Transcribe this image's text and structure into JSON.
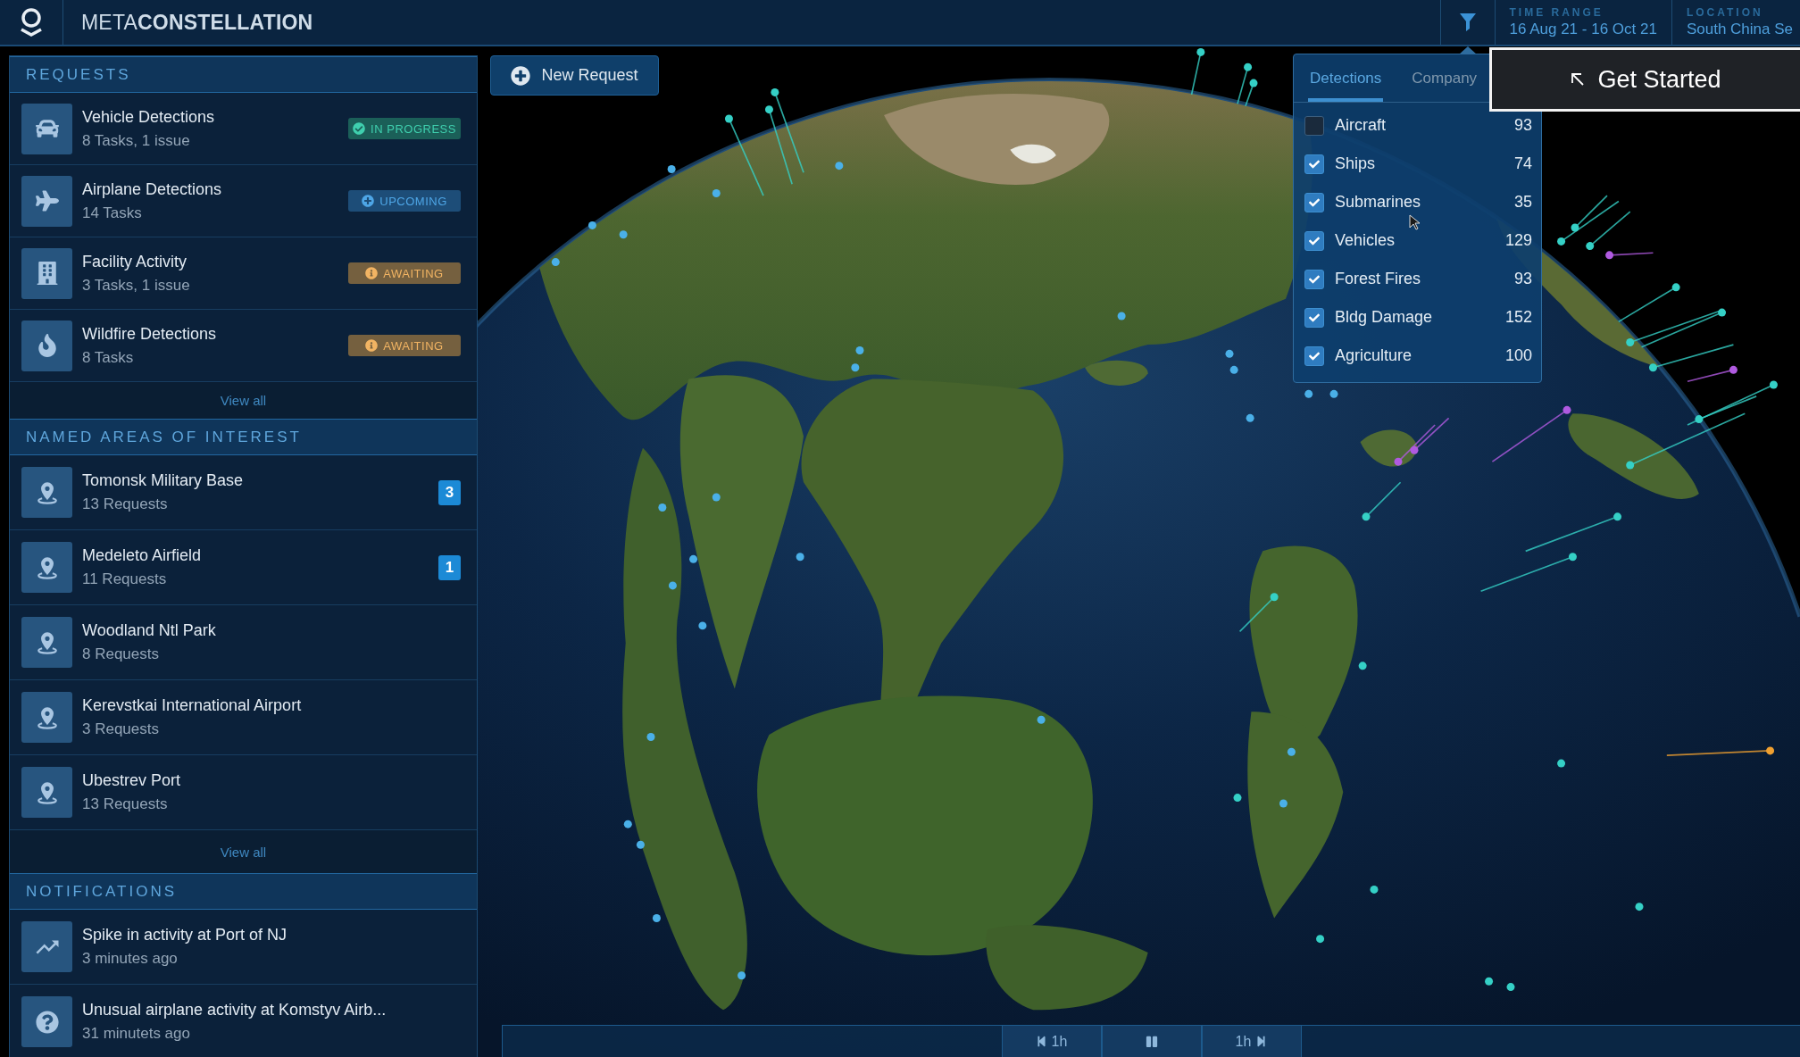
{
  "top_bar": {
    "title": "META**CONSTELLATION**",
    "time_range": {
      "label": "TIME RANGE",
      "value": "16 Aug 21 - 16 Oct 21"
    },
    "location": {
      "label": "LOCATION",
      "value": "South China Se"
    }
  },
  "get_started": {
    "label": "Get Started"
  },
  "new_request": {
    "label": "New Request"
  },
  "requests": {
    "title": "REQUESTS",
    "items": [
      {
        "kind": "vehicle",
        "name": "Vehicle Detections",
        "detail": "8 Tasks, 1 issue",
        "status": {
          "kind": "in_progress",
          "label": "IN PROGRESS"
        }
      },
      {
        "kind": "airplane",
        "name": "Airplane Detections",
        "detail": "14 Tasks",
        "status": {
          "kind": "upcoming",
          "label": "UPCOMING"
        }
      },
      {
        "kind": "facility",
        "name": "Facility Activity",
        "detail": "3 Tasks, 1 issue",
        "status": {
          "kind": "awaiting",
          "label": "AWAITING"
        }
      },
      {
        "kind": "wildfire",
        "name": "Wildfire Detections",
        "detail": "8 Tasks",
        "status": {
          "kind": "awaiting",
          "label": "AWAITING"
        }
      }
    ],
    "view_all": "View all"
  },
  "named_areas": {
    "title": "NAMED AREAS OF INTEREST",
    "items": [
      {
        "name": "Tomonsk Military Base",
        "detail": "13 Requests",
        "count": "3"
      },
      {
        "name": "Medeleto Airfield",
        "detail": "11 Requests",
        "count": "1"
      },
      {
        "name": "Woodland Ntl Park",
        "detail": "8 Requests"
      },
      {
        "name": "Kerevstkai International Airport",
        "detail": "3 Requests"
      },
      {
        "name": "Ubestrev Port",
        "detail": "13 Requests"
      }
    ],
    "view_all": "View all"
  },
  "notifications": {
    "title": "NOTIFICATIONS",
    "items": [
      {
        "kind": "trend",
        "title": "Spike in activity at Port of NJ",
        "time": "3 minutes ago"
      },
      {
        "kind": "question",
        "title": "Unusual airplane activity at Komstyv Airb...",
        "time": "31 minutets ago"
      }
    ]
  },
  "detections_panel": {
    "tabs": [
      {
        "label": "Detections",
        "selected": true
      },
      {
        "label": "Company",
        "selected": false
      }
    ],
    "items": [
      {
        "label": "Aircraft",
        "checked": false,
        "count": "93"
      },
      {
        "label": "Ships",
        "checked": true,
        "count": "74"
      },
      {
        "label": "Submarines",
        "checked": true,
        "count": "35"
      },
      {
        "label": "Vehicles",
        "checked": true,
        "count": "129"
      },
      {
        "label": "Forest Fires",
        "checked": true,
        "count": "93"
      },
      {
        "label": "Bldg Damage",
        "checked": true,
        "count": "152"
      },
      {
        "label": "Agriculture",
        "checked": true,
        "count": "100"
      }
    ]
  },
  "timeline": {
    "controls": [
      {
        "kind": "rewind",
        "label": "1h"
      },
      {
        "kind": "pause"
      },
      {
        "kind": "forward",
        "label": "1h"
      }
    ]
  }
}
